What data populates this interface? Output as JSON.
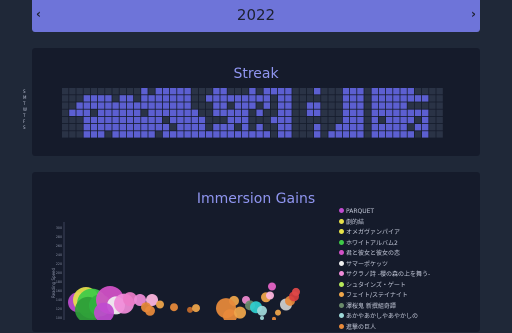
{
  "year_nav": {
    "year": "2022",
    "prev_glyph": "‹",
    "next_glyph": "›"
  },
  "streak": {
    "title": "Streak",
    "weekday_labels": [
      "S",
      "M",
      "T",
      "W",
      "T",
      "F",
      "S"
    ],
    "colors": {
      "empty": "#2a3346",
      "active": "#5c5fd1",
      "light": "#8d8fe8"
    },
    "chart_data": {
      "type": "heatmap",
      "title": "Streak",
      "rows": 7,
      "weeks": 53,
      "levels": [
        "00000000000101111100011000101111000100011101111110000",
        "00011110110111111100111111111011000000011101111111100",
        "00111111111111111100011011101011001100011101111100000",
        "01110111111011111110011111010011001100011101111111100",
        "00011111111111011111000111000111000000011101011110100",
        "00011111111111101111011101010011000100111101111101100",
        "00011101111110111111111111111011000101111101111110100"
      ]
    }
  },
  "gains": {
    "title": "Immersion Gains",
    "ylabel": "Reading Speed",
    "ytick_labels": [
      "300",
      "280",
      "260",
      "240",
      "220",
      "200",
      "180",
      "160",
      "140",
      "120",
      "100"
    ],
    "legend": [
      {
        "label": "PARQUET",
        "color": "#c04bd0"
      },
      {
        "label": "劇的結",
        "color": "#e6e04a"
      },
      {
        "label": "オメガヴァンパイア",
        "color": "#e8e34a"
      },
      {
        "label": "ホワイトアルバム2",
        "color": "#3ecb48"
      },
      {
        "label": "君と彼女と彼女の恋",
        "color": "#d451c8"
      },
      {
        "label": "サマーポケッツ",
        "color": "#f0f0f0"
      },
      {
        "label": "サクラノ詩 -櫻の森の上を舞う-",
        "color": "#f08bd8"
      },
      {
        "label": "シュタインズ・ゲート",
        "color": "#b7e85a"
      },
      {
        "label": "フェイト/ステイナイト",
        "color": "#f0a64a"
      },
      {
        "label": "澤桜鬼 新撰組奇譚",
        "color": "#6a8a6a"
      },
      {
        "label": "あかやあかしやあやかしの",
        "color": "#9fd9d9"
      },
      {
        "label": "進撃の巨人",
        "color": "#e88a3a"
      }
    ],
    "chart_data": {
      "type": "scatter",
      "ylabel": "Reading Speed",
      "ylim": [
        100,
        300
      ],
      "points": [
        {
          "x": 78,
          "y": 135,
          "size": 10,
          "color": "#c04bd0"
        },
        {
          "x": 86,
          "y": 140,
          "size": 13,
          "color": "#e6e04a"
        },
        {
          "x": 92,
          "y": 132,
          "size": 15,
          "color": "#3ecb48"
        },
        {
          "x": 88,
          "y": 118,
          "size": 13,
          "color": "#2e9e38"
        },
        {
          "x": 100,
          "y": 128,
          "size": 11,
          "color": "#30b040"
        },
        {
          "x": 110,
          "y": 140,
          "size": 14,
          "color": "#d451c8"
        },
        {
          "x": 116,
          "y": 128,
          "size": 9,
          "color": "#f0f0f0"
        },
        {
          "x": 124,
          "y": 132,
          "size": 10,
          "color": "#f08bd8"
        },
        {
          "x": 104,
          "y": 112,
          "size": 10,
          "color": "#c04bd0"
        },
        {
          "x": 130,
          "y": 142,
          "size": 7,
          "color": "#ec7cc8"
        },
        {
          "x": 140,
          "y": 140,
          "size": 6,
          "color": "#f08bd8"
        },
        {
          "x": 152,
          "y": 140,
          "size": 6,
          "color": "#ffb7e0"
        },
        {
          "x": 146,
          "y": 124,
          "size": 5,
          "color": "#e88a3a"
        },
        {
          "x": 150,
          "y": 116,
          "size": 5,
          "color": "#e88a3a"
        },
        {
          "x": 160,
          "y": 130,
          "size": 4,
          "color": "#f0a64a"
        },
        {
          "x": 174,
          "y": 124,
          "size": 4,
          "color": "#e88a3a"
        },
        {
          "x": 190,
          "y": 118,
          "size": 3,
          "color": "#c56a2a"
        },
        {
          "x": 196,
          "y": 122,
          "size": 4,
          "color": "#f0a64a"
        },
        {
          "x": 234,
          "y": 138,
          "size": 5,
          "color": "#f0a64a"
        },
        {
          "x": 226,
          "y": 122,
          "size": 10,
          "color": "#e88a3a"
        },
        {
          "x": 230,
          "y": 104,
          "size": 7,
          "color": "#e88a3a"
        },
        {
          "x": 240,
          "y": 112,
          "size": 6,
          "color": "#f0a64a"
        },
        {
          "x": 246,
          "y": 140,
          "size": 4,
          "color": "#ef8ad0"
        },
        {
          "x": 250,
          "y": 128,
          "size": 5,
          "color": "#6a8a6a"
        },
        {
          "x": 256,
          "y": 124,
          "size": 6,
          "color": "#2fd0d0"
        },
        {
          "x": 262,
          "y": 116,
          "size": 5,
          "color": "#9fd9d9"
        },
        {
          "x": 266,
          "y": 146,
          "size": 5,
          "color": "#f0a64a"
        },
        {
          "x": 270,
          "y": 150,
          "size": 4,
          "color": "#ffb7e0"
        },
        {
          "x": 272,
          "y": 170,
          "size": 4,
          "color": "#e865c8"
        },
        {
          "x": 278,
          "y": 112,
          "size": 3,
          "color": "#f0a64a"
        },
        {
          "x": 286,
          "y": 130,
          "size": 6,
          "color": "#d0d0d0"
        },
        {
          "x": 290,
          "y": 138,
          "size": 5,
          "color": "#e88a3a"
        },
        {
          "x": 294,
          "y": 148,
          "size": 5,
          "color": "#d84040"
        },
        {
          "x": 296,
          "y": 158,
          "size": 4,
          "color": "#e04848"
        },
        {
          "x": 274,
          "y": 98,
          "size": 2,
          "color": "#e88a3a"
        },
        {
          "x": 262,
          "y": 100,
          "size": 2,
          "color": "#9fd9d9"
        }
      ]
    }
  }
}
